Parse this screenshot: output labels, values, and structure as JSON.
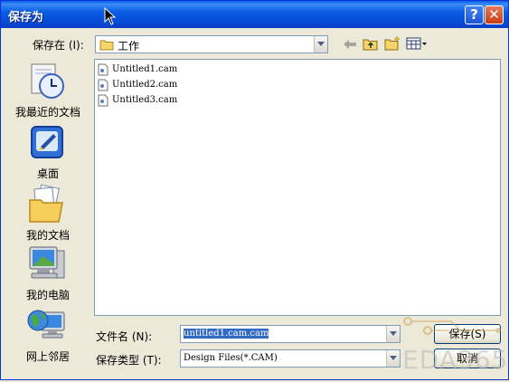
{
  "window": {
    "title": "保存为",
    "help_symbol": "?",
    "close_symbol": "✕"
  },
  "toolbar": {
    "save_in_label": "保存在 (I):",
    "current_folder": "工作",
    "icons": [
      "back-arrow-icon",
      "up-folder-icon",
      "new-folder-icon",
      "view-menu-icon"
    ]
  },
  "places": [
    {
      "label": "我最近的文档",
      "icon": "recent-documents-icon"
    },
    {
      "label": "桌面",
      "icon": "desktop-icon"
    },
    {
      "label": "我的文档",
      "icon": "my-documents-icon"
    },
    {
      "label": "我的电脑",
      "icon": "my-computer-icon"
    },
    {
      "label": "网上邻居",
      "icon": "network-places-icon"
    }
  ],
  "files": [
    "Untitled1.cam",
    "Untitled2.cam",
    "Untitled3.cam"
  ],
  "form": {
    "filename_label": "文件名 (N):",
    "filename_value": "untitled1.cam.cam",
    "filetype_label": "保存类型 (T):",
    "filetype_value": "Design Files(*.CAM)"
  },
  "buttons": {
    "save": "保存(S)",
    "cancel": "取消"
  },
  "watermark": "EDA365",
  "colors": {
    "title_bar": "#0a5fe6",
    "selection": "#316ac5",
    "dialog_bg": "#ece9d8"
  }
}
